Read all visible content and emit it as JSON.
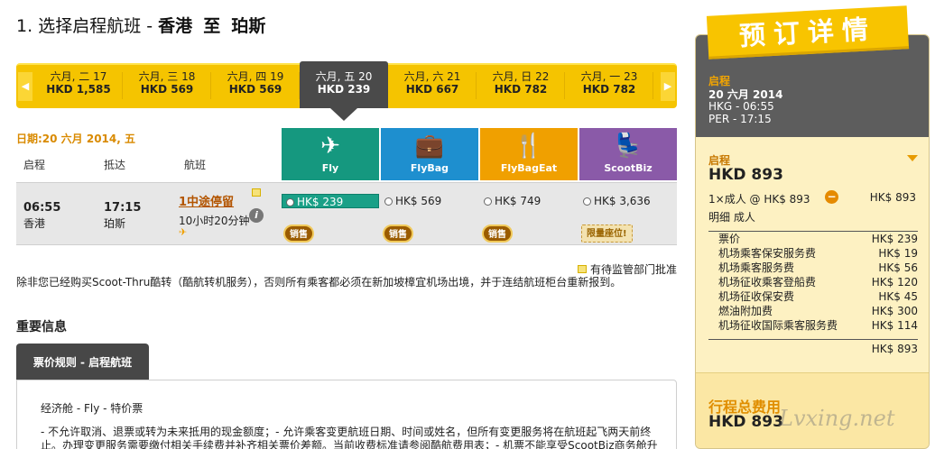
{
  "header": {
    "step": "1.",
    "label": "选择启程航班 -",
    "origin": "香港",
    "connector": "至",
    "destination": "珀斯"
  },
  "dates": [
    {
      "label": "六月, 二 17",
      "price": "HKD 1,585",
      "selected": false
    },
    {
      "label": "六月, 三 18",
      "price": "HKD 569",
      "selected": false
    },
    {
      "label": "六月, 四 19",
      "price": "HKD 569",
      "selected": false
    },
    {
      "label": "六月, 五 20",
      "price": "HKD 239",
      "selected": true
    },
    {
      "label": "六月, 六 21",
      "price": "HKD 667",
      "selected": false
    },
    {
      "label": "六月, 日 22",
      "price": "HKD 782",
      "selected": false
    },
    {
      "label": "六月, 一 23",
      "price": "HKD 782",
      "selected": false
    }
  ],
  "date_line": "日期:20 六月 2014, 五",
  "columns": {
    "depart": "启程",
    "arrive": "抵达",
    "flight": "航班"
  },
  "fare_types": [
    {
      "name": "Fly",
      "color": "#15987f",
      "icon": "airplane-icon",
      "glyph": "✈"
    },
    {
      "name": "FlyBag",
      "color": "#1e8fcf",
      "icon": "luggage-icon",
      "glyph": "💼"
    },
    {
      "name": "FlyBagEat",
      "color": "#f0a000",
      "icon": "meal-icon",
      "glyph": "🍴"
    },
    {
      "name": "ScootBiz",
      "color": "#8a5aa8",
      "icon": "seat-icon",
      "glyph": "💺"
    }
  ],
  "flight": {
    "dep_time": "06:55",
    "dep_city": "香港",
    "arr_time": "17:15",
    "arr_city": "珀斯",
    "stops": "1中途停留",
    "duration": "10小时20分钟",
    "plane": "✈",
    "fares": [
      {
        "price": "HK$ 239",
        "selected": true,
        "badge": "销售"
      },
      {
        "price": "HK$ 569",
        "selected": false,
        "badge": "销售"
      },
      {
        "price": "HK$ 749",
        "selected": false,
        "badge": "销售"
      },
      {
        "price": "HK$ 3,636",
        "selected": false,
        "badge": "限量座位!"
      }
    ]
  },
  "notices": {
    "approval": "有待监管部门批准",
    "transfer": "除非您已经购买Scoot-Thru酷转（酷航转机服务），否则所有乘客都必须在新加坡樟宜机场出境，并于连结航班柜台重新报到。"
  },
  "important": {
    "title": "重要信息",
    "tab": "票价规则 - 启程航班",
    "class_line": "经济舱 - Fly - 特价票",
    "text": "- 不允许取消、退票或转为未来抵用的现金额度；- 允许乘客变更航班日期、时间或姓名，但所有变更服务将在航班起飞两天前终止。办理变更服务需要缴付相关手续费并补齐相关票价差额。当前收费标准请参阅酷航费用表；- 机票不能享受ScootBiz商务舱升"
  },
  "booking": {
    "banner": "预订详情",
    "dep_label": "启程",
    "dep_date": "20 六月 2014",
    "dep_line": "HKG - 06:55",
    "arr_line": "PER - 17:15",
    "sub_label": "启程",
    "sub_price": "HKD 893",
    "pax_line": "1×成人 @ HK$ 893",
    "pax_price": "HK$ 893",
    "detail_label": "明细 成人",
    "fees": [
      {
        "name": "票价",
        "value": "HK$ 239"
      },
      {
        "name": "机场乘客保安服务费",
        "value": "HK$ 19"
      },
      {
        "name": "机场乘客服务费",
        "value": "HK$ 56"
      },
      {
        "name": "机场征收乘客登船费",
        "value": "HK$ 120"
      },
      {
        "name": "机场征收保安费",
        "value": "HK$ 45"
      },
      {
        "name": "燃油附加费",
        "value": "HK$ 300"
      },
      {
        "name": "机场征收国际乘客服务费",
        "value": "HK$ 114"
      }
    ],
    "fee_total": "HK$ 893",
    "total_label": "行程总费用",
    "total_price": "HKD 893",
    "watermark": "Lvxing.net"
  }
}
